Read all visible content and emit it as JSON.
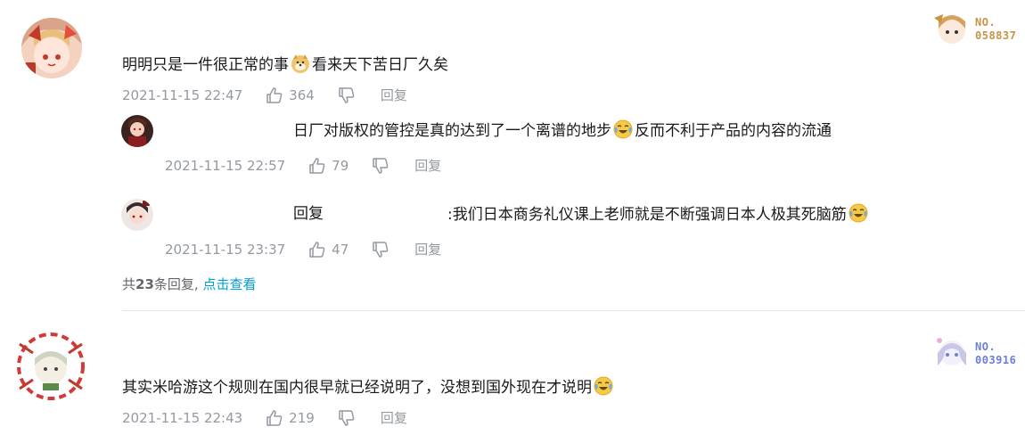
{
  "comments": [
    {
      "content_text": "明明只是一件很正常的事",
      "content_text_after": "看来天下苦日厂久矣",
      "time": "2021-11-15 22:47",
      "likes": "364",
      "reply_label": "回复",
      "badge_no_label": "NO.",
      "badge_no": "058837",
      "replies": [
        {
          "content_text": "日厂对版权的管控是真的达到了一个离谱的地步",
          "content_text_after": "反而不利于产品的内容的流通",
          "time": "2021-11-15 22:57",
          "likes": "79",
          "reply_label": "回复"
        },
        {
          "reply_prefix": "回复",
          "content_text": ":我们日本商务礼仪课上老师就是不断强调日本人极其死脑筋",
          "time": "2021-11-15 23:37",
          "likes": "47",
          "reply_label": "回复"
        }
      ],
      "more": {
        "prefix": "共",
        "count": "23",
        "suffix": "条回复,",
        "link": "点击查看"
      }
    },
    {
      "content_text": "其实米哈游这个规则在国内很早就已经说明了，没想到国外现在才说明",
      "time": "2021-11-15 22:43",
      "likes": "219",
      "reply_label": "回复",
      "badge_no_label": "NO.",
      "badge_no": "003916"
    }
  ],
  "colors": {
    "badge1": "#c79443",
    "badge2": "#6b7fd7",
    "link": "#00a1d6",
    "meta": "#9499a0"
  },
  "icons": [
    "like-icon",
    "dislike-icon",
    "doge-emoji",
    "laugh-cry-emoji"
  ]
}
